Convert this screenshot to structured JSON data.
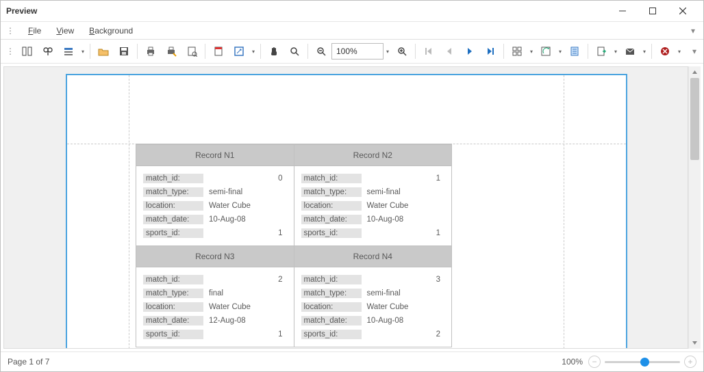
{
  "window": {
    "title": "Preview"
  },
  "menu": {
    "file": "File",
    "view": "View",
    "background": "Background"
  },
  "toolbar": {
    "zoom_value": "100%"
  },
  "status": {
    "page_label": "Page 1 of 7",
    "zoom_label": "100%"
  },
  "fields": {
    "match_id": "match_id:",
    "match_type": "match_type:",
    "location": "location:",
    "match_date": "match_date:",
    "sports_id": "sports_id:"
  },
  "records": [
    {
      "header": "Record N1",
      "match_id": "0",
      "match_type": "semi-final",
      "location": "Water Cube",
      "match_date": "10-Aug-08",
      "sports_id": "1"
    },
    {
      "header": "Record N2",
      "match_id": "1",
      "match_type": "semi-final",
      "location": "Water Cube",
      "match_date": "10-Aug-08",
      "sports_id": "1"
    },
    {
      "header": "Record N3",
      "match_id": "2",
      "match_type": "final",
      "location": "Water Cube",
      "match_date": "12-Aug-08",
      "sports_id": "1"
    },
    {
      "header": "Record N4",
      "match_id": "3",
      "match_type": "semi-final",
      "location": "Water Cube",
      "match_date": "10-Aug-08",
      "sports_id": "2"
    }
  ]
}
